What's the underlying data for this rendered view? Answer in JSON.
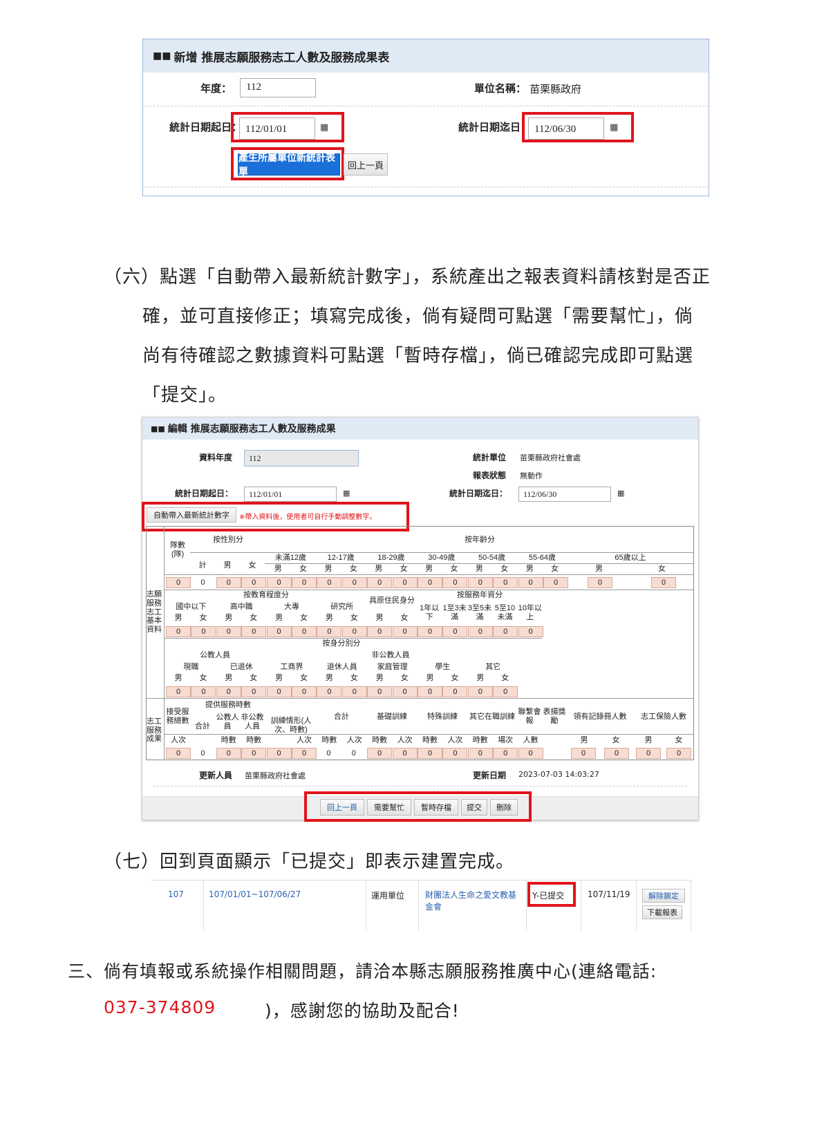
{
  "form1": {
    "title": "新增 推展志願服務志工人數及服務成果表",
    "year_label": "年度：",
    "year_value": "112",
    "unit_label": "單位名稱：",
    "unit_value": "苗栗縣政府",
    "start_label": "統計日期起日：",
    "start_value": "112/01/01",
    "end_label": "統計日期迄日：",
    "end_value": "112/06/30",
    "generate_button": "產生所屬單位新統計表單",
    "back_button": "回上一頁"
  },
  "step6": {
    "line1": "（六）點選「自動帶入最新統計數字」，系統產出之報表資料請核對是否正",
    "line2": "確，並可直接修正；填寫完成後，倘有疑問可點選「需要幫忙」，倘",
    "line3": "尚有待確認之數據資料可點選「暫時存檔」，倘已確認完成即可點選",
    "line4": "「提交」。"
  },
  "form2": {
    "title": "編輯 推展志願服務志工人數及服務成果",
    "year_label": "資料年度",
    "year_value": "112",
    "stat_unit_label": "統計單位",
    "stat_unit_value": "苗栗縣政府社會處",
    "status_label": "報表狀態",
    "status_value": "無動作",
    "start_label": "統計日期起日：",
    "start_value": "112/01/01",
    "end_label": "統計日期迄日：",
    "end_value": "112/06/30",
    "auto_button": "自動帶入最新統計數字",
    "auto_note": "※帶入資料後，使用者可自行手動調整數字。",
    "updater_label": "更新人員",
    "updater_value": "苗栗縣政府社會處",
    "update_date_label": "更新日期",
    "update_date_value": "2023-07-03 14:03:27",
    "buttons": [
      "回上一頁",
      "需要幫忙",
      "暫時存檔",
      "提交",
      "刪除"
    ]
  },
  "table": {
    "section_basic": "志願服務志工基本資料",
    "section_result": "志工服務成果",
    "team_count": "隊數(隊)",
    "by_gender": "按性別分",
    "total": "計",
    "male": "男",
    "female": "女",
    "by_age": "按年齡分",
    "age_groups": [
      "未滿12歲",
      "12-17歲",
      "18-29歲",
      "30-49歲",
      "50-54歲",
      "55-64歲",
      "65歲以上"
    ],
    "by_edu": "按教育程度分",
    "edu_groups": [
      "國中以下",
      "高中職",
      "大專",
      "研究所"
    ],
    "indigenous": "具原住民身分",
    "by_years": "按服務年資分",
    "years_groups": [
      "1年以下",
      "1至3未滿",
      "3至5未滿",
      "5至10未滿",
      "10年以上"
    ],
    "by_identity": "按身分別分",
    "public_servant": "公教人員",
    "non_public": "非公教人員",
    "identity_groups": [
      "現職",
      "已退休",
      "工商界",
      "退休人員",
      "家庭管理",
      "學生",
      "其它"
    ],
    "served_total": "接受服務總數",
    "served_unit": "人次",
    "service_hours": "提供服務時數",
    "hours_total": "合計",
    "hours_public": "公教人員",
    "hours_nonpublic": "非公教人員",
    "hours": "時數",
    "training": "訓練情形(人次、時數)",
    "train_total": "合計",
    "train_basic": "基礎訓練",
    "train_special": "特殊訓練",
    "train_other": "其它在職訓練",
    "people_times": "人次",
    "meetings": "聯繫會報",
    "meetings_unit": "場次",
    "awards": "表揚獎勵",
    "awards_unit": "人數",
    "record_books": "領有記錄冊人數",
    "insurance": "志工保險人數",
    "zero": "0"
  },
  "step7": {
    "text": "（七）回到頁面顯示「已提交」即表示建置完成。"
  },
  "result_row": {
    "year": "107",
    "period": "107/01/01~107/06/27",
    "type": "運用單位",
    "org": "財團法人生命之愛文教基金會",
    "status": "Y-已提交",
    "date": "107/11/19",
    "unlock_button": "解除鎖定",
    "download_button": "下載報表"
  },
  "step3": {
    "line1": "三、倘有填報或系統操作相關問題，請洽本縣志願服務推廣中心(連絡電話:",
    "phone": "037-374809",
    "line2_tail": ")，感謝您的協助及配合!"
  },
  "colors": {
    "accent_red": "#e0141b",
    "header_blue": "#dfeaf5",
    "primary_blue": "#1a6fd8",
    "cell_fill": "#f7dcd2"
  }
}
